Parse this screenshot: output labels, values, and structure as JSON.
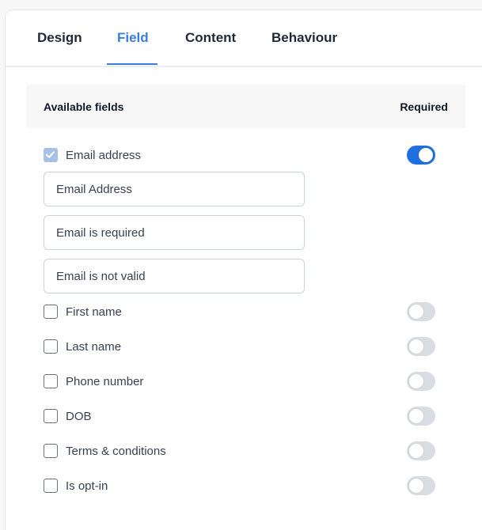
{
  "tabs": [
    {
      "label": "Design"
    },
    {
      "label": "Field",
      "active": true
    },
    {
      "label": "Content"
    },
    {
      "label": "Behaviour"
    }
  ],
  "table_header": {
    "available_fields": "Available fields",
    "required": "Required"
  },
  "email": {
    "label": "Email address",
    "checked": true,
    "required": true,
    "inputs": {
      "label_value": "Email Address",
      "required_message": "Email is required",
      "invalid_message": "Email is not valid"
    }
  },
  "fields": [
    {
      "label": "First name",
      "checked": false,
      "required": false
    },
    {
      "label": "Last name",
      "checked": false,
      "required": false
    },
    {
      "label": "Phone number",
      "checked": false,
      "required": false
    },
    {
      "label": "DOB",
      "checked": false,
      "required": false
    },
    {
      "label": "Terms & conditions",
      "checked": false,
      "required": false
    },
    {
      "label": "Is opt-in",
      "checked": false,
      "required": false
    }
  ],
  "colors": {
    "accent": "#3b7ddd",
    "toggle_on": "#1f6fe0",
    "toggle_off": "#d8dde4",
    "checkbox_checked": "#a8c1e6"
  },
  "icons": {
    "checkmark": "check-icon"
  }
}
